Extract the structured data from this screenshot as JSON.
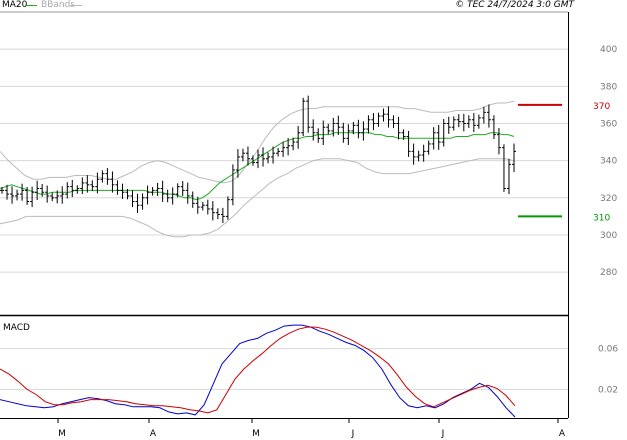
{
  "header": {
    "legend_ma": "MA20",
    "legend_bbands": "BBands",
    "copyright": "© TEC 24/7/2024 3:0 GMT"
  },
  "colors": {
    "ma": "#22aa22",
    "bbands": "#bbbbbb",
    "resistance": "#cc0000",
    "support": "#009900",
    "macd": "#0000cc",
    "signal": "#cc0000",
    "grid": "#d8d8d8"
  },
  "chart_data": [
    {
      "type": "ohlc",
      "title": "",
      "ylim": [
        258,
        420
      ],
      "y_ticks": [
        280,
        300,
        320,
        340,
        360,
        380,
        400
      ],
      "x_month_labels": [
        "M",
        "A",
        "M",
        "J",
        "J",
        "A"
      ],
      "grid": true,
      "levels": [
        {
          "name": "resistance",
          "value": 370,
          "label": "370"
        },
        {
          "name": "support",
          "value": 310,
          "label": "310"
        }
      ],
      "series": [
        {
          "name": "price",
          "kind": "ohlc",
          "close": [
            324,
            322,
            321,
            322,
            324,
            318,
            323,
            325,
            323,
            321,
            320,
            321,
            322,
            326,
            324,
            325,
            328,
            327,
            326,
            330,
            333,
            330,
            327,
            324,
            323,
            321,
            318,
            316,
            320,
            323,
            324,
            325,
            322,
            320,
            322,
            326,
            324,
            321,
            317,
            315,
            316,
            314,
            312,
            311,
            310,
            319,
            335,
            342,
            344,
            341,
            339,
            343,
            341,
            342,
            344,
            345,
            347,
            348,
            350,
            355,
            372,
            358,
            355,
            352,
            358,
            356,
            360,
            358,
            352,
            356,
            359,
            355,
            357,
            362,
            360,
            364,
            365,
            362,
            360,
            355,
            353,
            345,
            342,
            343,
            345,
            349,
            355,
            350,
            360,
            358,
            362,
            361,
            360,
            362,
            359,
            363,
            366,
            362,
            354,
            347,
            325,
            338,
            345
          ]
        },
        {
          "name": "MA20",
          "kind": "line",
          "values": [
            325,
            326,
            327,
            326,
            325,
            324,
            323,
            322,
            322,
            323,
            323,
            323,
            323,
            324,
            324,
            324,
            324,
            324,
            324,
            324,
            324,
            324,
            324,
            324,
            324,
            324,
            323,
            323,
            323,
            322,
            322,
            321,
            320,
            320,
            319,
            320,
            322,
            325,
            328,
            330,
            332,
            334,
            336,
            338,
            340,
            342,
            344,
            346,
            348,
            350,
            351,
            352,
            352,
            353,
            353,
            354,
            354,
            354,
            355,
            355,
            355,
            355,
            355,
            355,
            355,
            354,
            354,
            353,
            353,
            352,
            352,
            352,
            352,
            352,
            352,
            352,
            352,
            352,
            352,
            353,
            353,
            353,
            354,
            354,
            354,
            355,
            355,
            354,
            354,
            353
          ]
        },
        {
          "name": "BBands upper",
          "kind": "line",
          "values": [
            345,
            340,
            336,
            332,
            330,
            330,
            331,
            331,
            331,
            332,
            332,
            332,
            331,
            330,
            330,
            332,
            334,
            337,
            339,
            340,
            339,
            337,
            335,
            333,
            331,
            330,
            329,
            328,
            329,
            333,
            339,
            345,
            352,
            358,
            362,
            365,
            367,
            368,
            368,
            369,
            369,
            369,
            369,
            369,
            369,
            369,
            369,
            369,
            369,
            368,
            368,
            367,
            366,
            366,
            366,
            367,
            367,
            367,
            368,
            370,
            371,
            371,
            372
          ]
        },
        {
          "name": "BBands lower",
          "kind": "line",
          "values": [
            306,
            307,
            308,
            310,
            310,
            310,
            310,
            310,
            310,
            310,
            310,
            310,
            310,
            310,
            310,
            309,
            307,
            305,
            302,
            300,
            299,
            299,
            300,
            300,
            301,
            303,
            307,
            311,
            316,
            320,
            324,
            328,
            331,
            333,
            336,
            338,
            340,
            341,
            341,
            341,
            340,
            339,
            336,
            334,
            333,
            333,
            333,
            333,
            334,
            335,
            336,
            337,
            338,
            339,
            340,
            341,
            341,
            341,
            341,
            340
          ]
        }
      ]
    },
    {
      "type": "line",
      "title": "MACD",
      "ylim": [
        -0.8,
        8.8
      ],
      "y_ticks": [
        0.2,
        0.6
      ],
      "y_tick_labels": [
        "0.02",
        "0.06"
      ],
      "grid": true,
      "series": [
        {
          "name": "MACD",
          "values": [
            1.0,
            0.8,
            0.6,
            0.4,
            0.3,
            0.2,
            0.3,
            0.6,
            0.8,
            1.0,
            1.2,
            1.1,
            0.9,
            0.6,
            0.5,
            0.3,
            0.3,
            0.3,
            0.2,
            -0.2,
            -0.4,
            -0.3,
            -0.5,
            0.5,
            2.5,
            4.5,
            5.5,
            6.5,
            6.8,
            7.0,
            7.5,
            7.8,
            8.2,
            8.3,
            8.3,
            8.1,
            7.7,
            7.4,
            7.0,
            6.6,
            6.3,
            5.8,
            5.1,
            4.0,
            2.5,
            1.2,
            0.4,
            0.2,
            0.4,
            0.2,
            0.6,
            1.2,
            1.6,
            2.0,
            2.6,
            2.2,
            1.3,
            0.2,
            -0.7
          ]
        },
        {
          "name": "Signal",
          "values": [
            4.0,
            3.5,
            2.8,
            2.0,
            1.5,
            0.8,
            0.5,
            0.5,
            0.7,
            0.8,
            1.0,
            1.0,
            1.0,
            0.9,
            0.8,
            0.6,
            0.5,
            0.4,
            0.4,
            0.3,
            0.2,
            0.0,
            -0.1,
            -0.3,
            0.0,
            1.5,
            3.0,
            4.0,
            4.8,
            5.5,
            6.3,
            7.0,
            7.5,
            7.9,
            8.1,
            8.1,
            7.9,
            7.6,
            7.2,
            6.8,
            6.3,
            5.8,
            5.2,
            4.5,
            3.4,
            2.2,
            1.3,
            0.6,
            0.3,
            0.7,
            1.1,
            1.5,
            1.9,
            2.2,
            2.4,
            2.1,
            1.4,
            0.4
          ]
        }
      ]
    }
  ]
}
